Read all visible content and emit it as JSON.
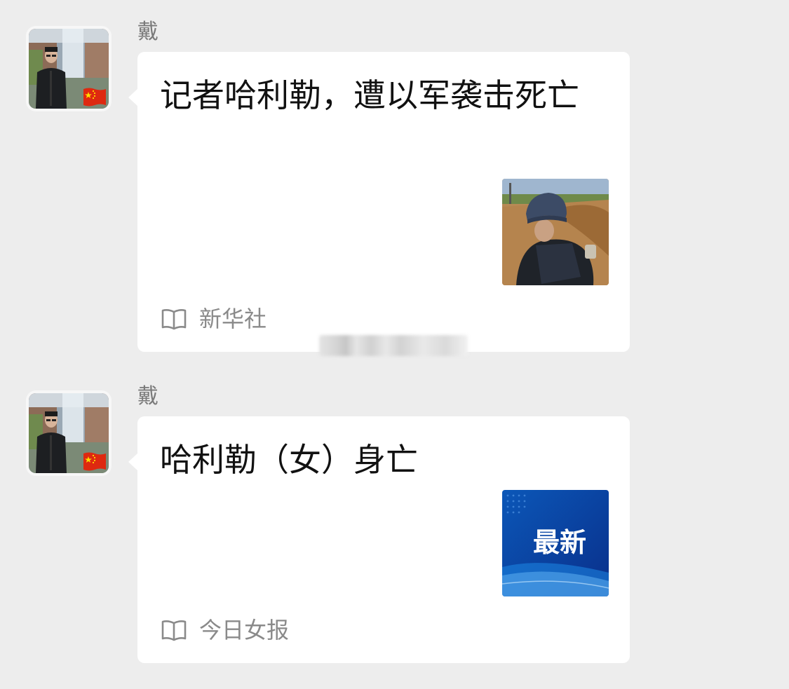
{
  "messages": [
    {
      "sender": "戴",
      "title": "记者哈利勒，遭以军袭击死亡",
      "source": "新华社",
      "source_icon": "open-book-icon",
      "thumbnail": "journalist-in-press-helmet-photo",
      "avatar": "user-avatar-with-china-flag"
    },
    {
      "sender": "戴",
      "title": "哈利勒（女）身亡",
      "source": "今日女报",
      "source_icon": "open-book-icon",
      "thumbnail": "breaking-news-blue-banner",
      "thumbnail_text": "最新",
      "avatar": "user-avatar-with-china-flag"
    }
  ],
  "colors": {
    "background": "#ededed",
    "bubble": "#ffffff",
    "sender_text": "#7a7a7a",
    "source_text": "#8a8a8a",
    "flag_red": "#de2910",
    "flag_yellow": "#ffde00",
    "news_blue": "#1565c0"
  }
}
